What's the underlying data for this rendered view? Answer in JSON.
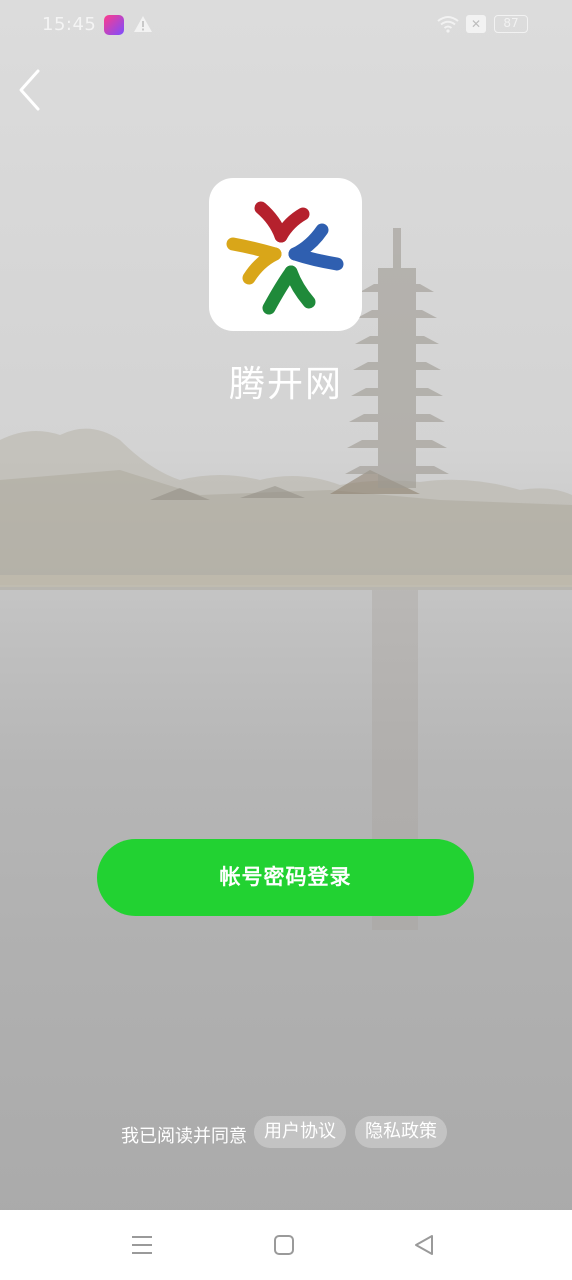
{
  "status_bar": {
    "time": "15:45",
    "battery": "87",
    "sim_label": "✕"
  },
  "app": {
    "name": "腾开网",
    "logo_colors": [
      "#b5212d",
      "#2f5fb0",
      "#1f8a3a",
      "#d9a619"
    ]
  },
  "login": {
    "button_label": "帐号密码登录",
    "button_color": "#22d232"
  },
  "agreement": {
    "prefix": "我已阅读并同意",
    "user_agreement": "用户协议",
    "privacy_policy": "隐私政策"
  },
  "icons": {
    "back": "chevron-left-icon",
    "nav_menu": "menu-icon",
    "nav_home": "square-home-icon",
    "nav_back": "triangle-back-icon"
  }
}
